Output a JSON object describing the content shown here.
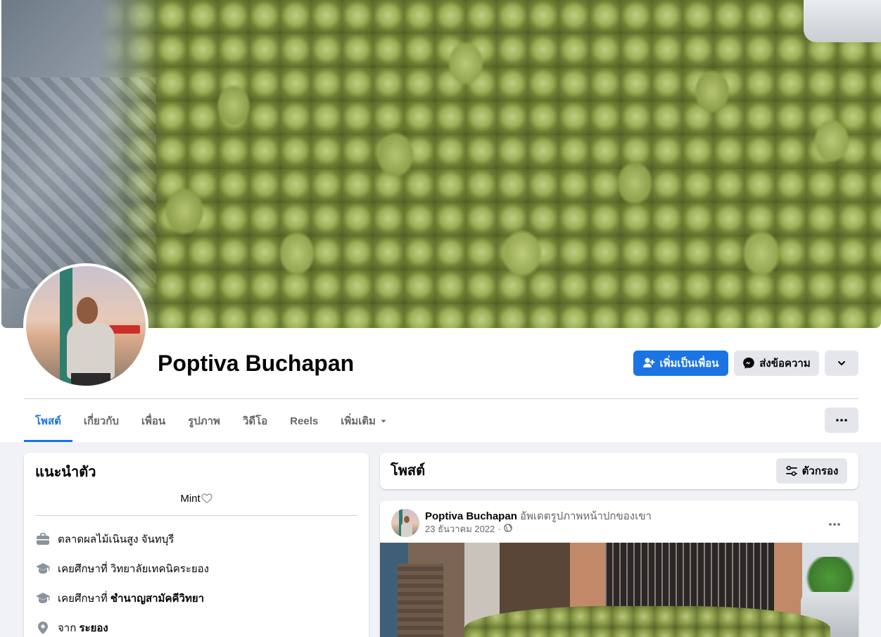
{
  "profile": {
    "name": "Poptiva Buchapan"
  },
  "actions": {
    "add_friend": "เพิ่มเป็นเพื่อน",
    "message": "ส่งข้อความ"
  },
  "tabs": [
    {
      "label": "โพสต์",
      "active": true
    },
    {
      "label": "เกี่ยวกับ",
      "active": false
    },
    {
      "label": "เพื่อน",
      "active": false
    },
    {
      "label": "รูปภาพ",
      "active": false
    },
    {
      "label": "วิดีโอ",
      "active": false
    },
    {
      "label": "Reels",
      "active": false
    },
    {
      "label": "เพิ่มเติม",
      "active": false
    }
  ],
  "intro": {
    "title": "แนะนำตัว",
    "bio": "Mint",
    "items": [
      {
        "icon": "briefcase-icon",
        "text": "ตลาดผลไม้เนินสูง จันทบุรี"
      },
      {
        "icon": "graduation-cap-icon",
        "prefix": "เคยศึกษาที่ ",
        "text": "วิทยาลัยเทคนิคระยอง"
      },
      {
        "icon": "graduation-cap-icon",
        "prefix": "เคยศึกษาที่ ",
        "text": "ชำนาญสามัคคีวิทยา"
      },
      {
        "icon": "location-pin-icon",
        "prefix": "จาก ",
        "text": "ระยอง"
      }
    ]
  },
  "posts": {
    "title": "โพสต์",
    "filter_label": "ตัวกรอง",
    "items": [
      {
        "author": "Poptiva Buchapan",
        "action": "อัพเดตรูปภาพหน้าปกของเขา",
        "date": "23 ธันวาคม 2022",
        "separator": "·",
        "audience_icon": "globe-icon"
      }
    ]
  },
  "colors": {
    "accent": "#1b74e4",
    "background": "#f0f2f5",
    "secondary_button": "#e4e6eb",
    "muted_text": "#65676b"
  }
}
